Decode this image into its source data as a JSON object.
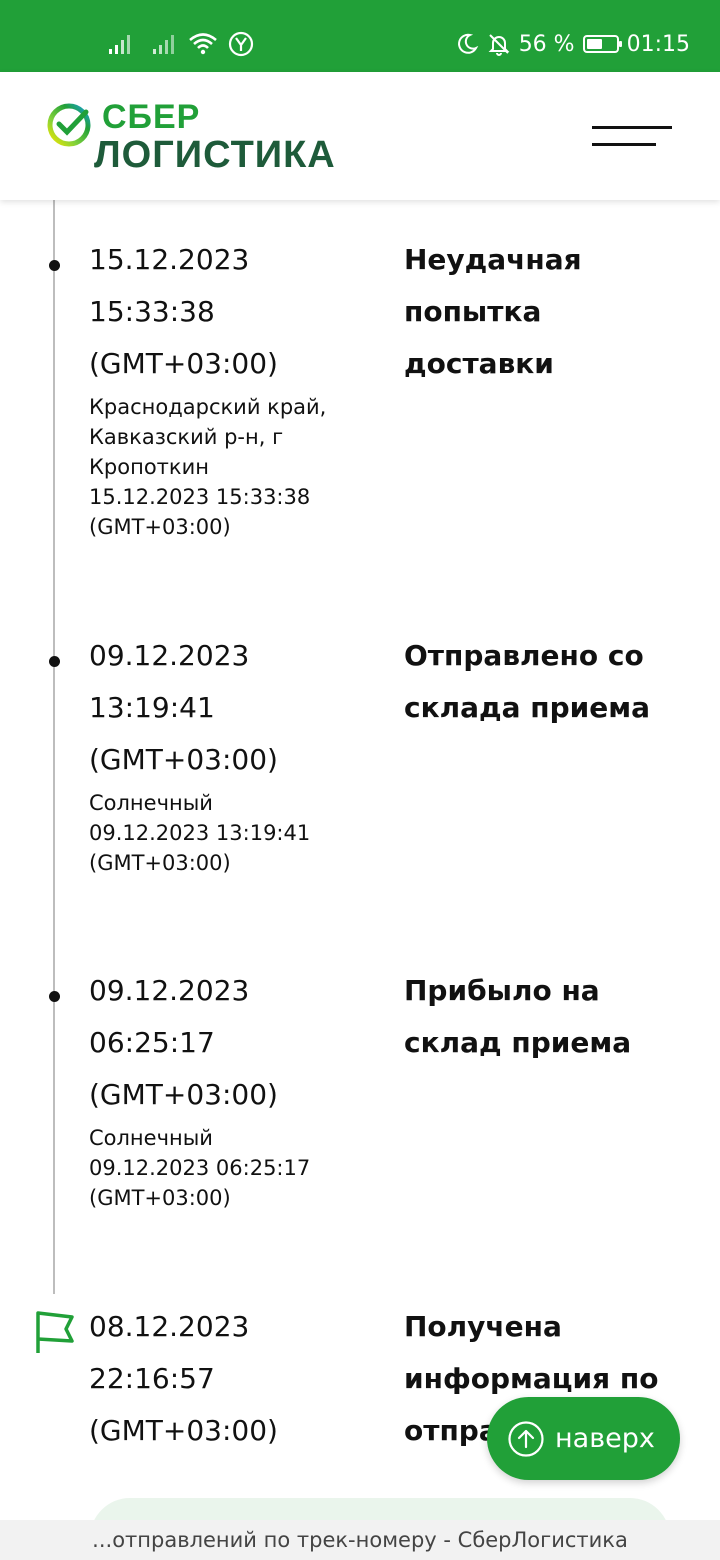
{
  "status_bar": {
    "battery_text": "56 %",
    "battery_level": 0.56,
    "time": "01:15",
    "icons": [
      "signal-icon",
      "signal-icon",
      "wifi-icon",
      "yandex-icon",
      "moon-icon",
      "bell-off-icon",
      "battery-icon"
    ]
  },
  "header": {
    "logo_line1": "СБЕР",
    "logo_line2": "ЛОГИСТИКА",
    "brand_green": "#21a038",
    "brand_dark": "#1e5b3a",
    "menu_icon": "hamburger-menu-icon"
  },
  "events": [
    {
      "date": "15.12.2023",
      "time": "15:33:38",
      "tz": "(GMT+03:00)",
      "location_lines": [
        "Краснодарский край,",
        "Кавказский р-н, г",
        "Кропоткин",
        "15.12.2023 15:33:38",
        "(GMT+03:00)"
      ],
      "status_lines": [
        "Неудачная",
        "попытка",
        "доставки"
      ]
    },
    {
      "date": "09.12.2023",
      "time": "13:19:41",
      "tz": "(GMT+03:00)",
      "location_lines": [
        "Солнечный",
        "09.12.2023 13:19:41",
        "(GMT+03:00)"
      ],
      "status_lines": [
        "Отправлено со",
        "склада приема"
      ]
    },
    {
      "date": "09.12.2023",
      "time": "06:25:17",
      "tz": "(GMT+03:00)",
      "location_lines": [
        "Солнечный",
        "09.12.2023 06:25:17",
        "(GMT+03:00)"
      ],
      "status_lines": [
        "Прибыло на",
        "склад приема"
      ]
    },
    {
      "date": "08.12.2023",
      "time": "22:16:57",
      "tz": "(GMT+03:00)",
      "location_lines": [],
      "status_lines": [
        "Получена",
        "информация по",
        "отпра"
      ]
    }
  ],
  "up_button": {
    "label": "наверх",
    "icon": "arrow-up-circle-icon"
  },
  "browser": {
    "url_title": "...отправлений по трек-номеру - СберЛогистика"
  }
}
